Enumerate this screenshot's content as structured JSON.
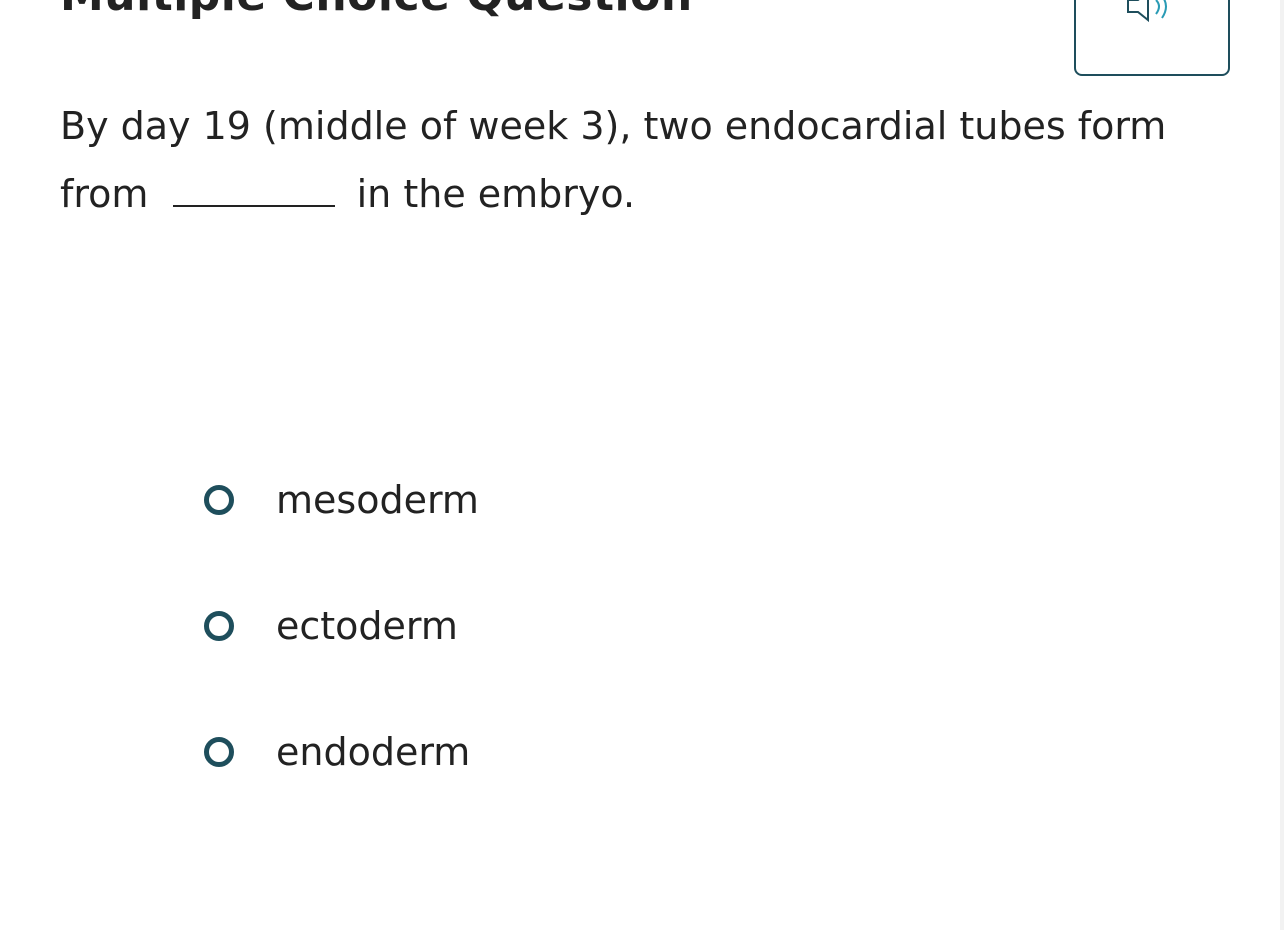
{
  "header": {
    "title": "Multiple Choice Question"
  },
  "audio": {
    "icon": "speaker-icon",
    "accent": "#1e4e5c",
    "wave_color": "#2a9bb5"
  },
  "question": {
    "part1": "By day 19 (middle of week 3), two endocardial tubes form from",
    "part2": "in the embryo."
  },
  "options": [
    {
      "label": "mesoderm"
    },
    {
      "label": "ectoderm"
    },
    {
      "label": "endoderm"
    }
  ]
}
